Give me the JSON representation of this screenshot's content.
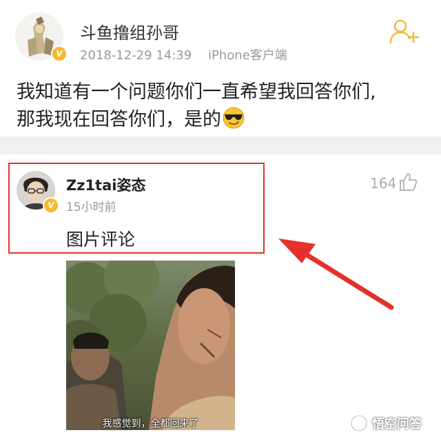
{
  "post": {
    "username": "斗鱼撸组孙哥",
    "date": "2018-12-29 14:39",
    "client": "iPhone客户端",
    "content_line1": "我知道有一个问题你们一直希望我回答你们,",
    "content_line2": "那我现在回答你们，是的",
    "verified_badge": "V"
  },
  "comment": {
    "username": "Zz1tai姿态",
    "time": "15小时前",
    "text": "图片评论",
    "likes": "164",
    "verified_badge": "V"
  },
  "image": {
    "subtitle": "我感觉到，全都回来了"
  },
  "watermark": {
    "text": "悟空问答"
  },
  "colors": {
    "highlight": "#e4312b",
    "badge": "#f5b82e",
    "follow": "#f5b82e"
  }
}
